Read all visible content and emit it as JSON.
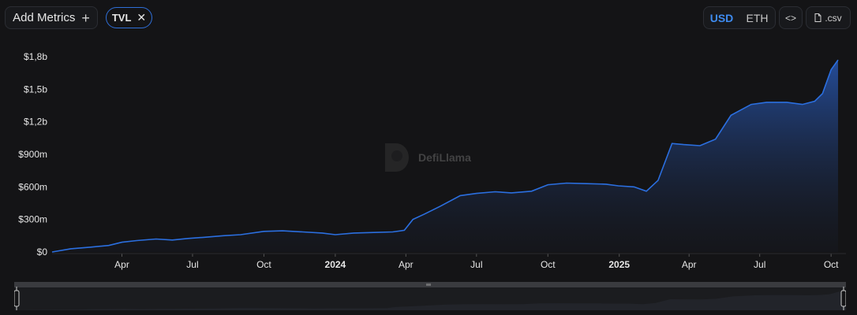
{
  "toolbar": {
    "add_metrics_label": "Add Metrics",
    "add_icon": "+",
    "metric_chip": "TVL",
    "chip_close": "✕",
    "currency_options": [
      "USD",
      "ETH"
    ],
    "selected_currency": "USD",
    "embed_label": "<>",
    "csv_label": ".csv"
  },
  "watermark": "DefiLlama",
  "colors": {
    "accent": "#2f6fd8",
    "line": "#2b6fe0",
    "background": "#141416"
  },
  "chart_data": {
    "type": "area",
    "series": [
      {
        "x": [
          "2023-01-01",
          "2023-01-25",
          "2023-02-20",
          "2023-03-15",
          "2023-04-01",
          "2023-04-20",
          "2023-05-15",
          "2023-06-05",
          "2023-06-25",
          "2023-07-15",
          "2023-08-10",
          "2023-09-01",
          "2023-10-01",
          "2023-10-25",
          "2023-11-20",
          "2023-12-15",
          "2024-01-01",
          "2024-01-25",
          "2024-02-20",
          "2024-03-15",
          "2024-03-30",
          "2024-04-10",
          "2024-04-25",
          "2024-05-15",
          "2024-06-10",
          "2024-07-01",
          "2024-07-25",
          "2024-08-15",
          "2024-09-10",
          "2024-10-01",
          "2024-10-25",
          "2024-11-20",
          "2024-12-15",
          "2024-12-31",
          "2025-01-20",
          "2025-02-05",
          "2025-02-20",
          "2025-03-10",
          "2025-03-25",
          "2025-04-15",
          "2025-05-05",
          "2025-05-25",
          "2025-06-20",
          "2025-07-10",
          "2025-08-05",
          "2025-08-25",
          "2025-09-10",
          "2025-09-20",
          "2025-10-01",
          "2025-10-10"
        ],
        "values": [
          0,
          30,
          45,
          60,
          90,
          105,
          120,
          110,
          125,
          135,
          150,
          160,
          190,
          195,
          185,
          175,
          160,
          175,
          180,
          185,
          200,
          300,
          350,
          420,
          520,
          540,
          555,
          545,
          560,
          620,
          635,
          630,
          625,
          610,
          600,
          560,
          660,
          1000,
          990,
          980,
          1040,
          1260,
          1360,
          1380,
          1380,
          1360,
          1390,
          1460,
          1680,
          1770
        ]
      }
    ],
    "y_ticks": [
      "$0",
      "$300m",
      "$600m",
      "$900m",
      "$1,2b",
      "$1,5b",
      "$1,8b"
    ],
    "y_tick_values": [
      0,
      300,
      600,
      900,
      1200,
      1500,
      1800
    ],
    "x_ticks": [
      "Apr",
      "Jul",
      "Oct",
      "2024",
      "Apr",
      "Jul",
      "Oct",
      "2025",
      "Apr",
      "Jul",
      "Oct"
    ],
    "x_tick_dates": [
      "2023-04-01",
      "2023-07-01",
      "2023-10-01",
      "2024-01-01",
      "2024-04-01",
      "2024-07-01",
      "2024-10-01",
      "2025-01-01",
      "2025-04-01",
      "2025-07-01",
      "2025-10-01"
    ],
    "x_major_ticks": [
      "2024",
      "2025"
    ],
    "ylim": [
      0,
      1800
    ],
    "xlim": [
      "2023-01-01",
      "2025-10-10"
    ],
    "grid": false
  }
}
